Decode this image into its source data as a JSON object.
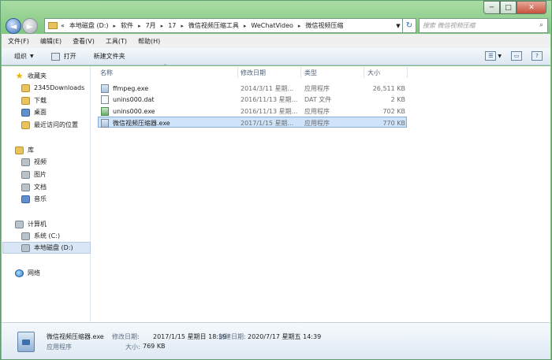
{
  "window": {
    "min_label": "─",
    "max_label": "□",
    "close_label": "✕"
  },
  "address": {
    "prefix": "«",
    "segments": [
      "本地磁盘 (D:)",
      "软件",
      "7月",
      "17",
      "微信视频压缩工具",
      "WeChatVideo",
      "微信视频压缩"
    ],
    "separator": "▸"
  },
  "search": {
    "placeholder": "搜索 微信视频压缩"
  },
  "menu": [
    "文件(F)",
    "编辑(E)",
    "查看(V)",
    "工具(T)",
    "帮助(H)"
  ],
  "toolbar": {
    "organize": "组织",
    "open": "打开",
    "new_folder": "新建文件夹"
  },
  "nav": {
    "favorites": "收藏夹",
    "downloads": "2345Downloads",
    "download": "下载",
    "desktop": "桌面",
    "recent": "最近访问的位置",
    "libraries": "库",
    "videos": "视频",
    "pictures": "图片",
    "documents": "文档",
    "music": "音乐",
    "computer": "计算机",
    "drive_c": "系统 (C:)",
    "drive_d": "本地磁盘 (D:)",
    "network": "网络"
  },
  "columns": {
    "name": "名称",
    "date": "修改日期",
    "type": "类型",
    "size": "大小"
  },
  "files": [
    {
      "name": "ffmpeg.exe",
      "date": "2014/3/11 星期...",
      "type": "应用程序",
      "size": "26,511 KB",
      "icon": "exe-icon"
    },
    {
      "name": "unins000.dat",
      "date": "2016/11/13 星期...",
      "type": "DAT 文件",
      "size": "2 KB",
      "icon": "dat-file-icon"
    },
    {
      "name": "unins000.exe",
      "date": "2016/11/13 星期...",
      "type": "应用程序",
      "size": "702 KB",
      "icon": "uninstaller-icon"
    },
    {
      "name": "微信视频压缩器.exe",
      "date": "2017/1/15 星期...",
      "type": "应用程序",
      "size": "770 KB",
      "icon": "exe-icon"
    }
  ],
  "details": {
    "name": "微信视频压缩器.exe",
    "type": "应用程序",
    "modified_label": "修改日期:",
    "modified_value": "2017/1/15 星期日 18:39",
    "created_label": "创建日期:",
    "created_value": "2020/7/17 星期五 14:39",
    "size_label": "大小:",
    "size_value": "769 KB"
  }
}
